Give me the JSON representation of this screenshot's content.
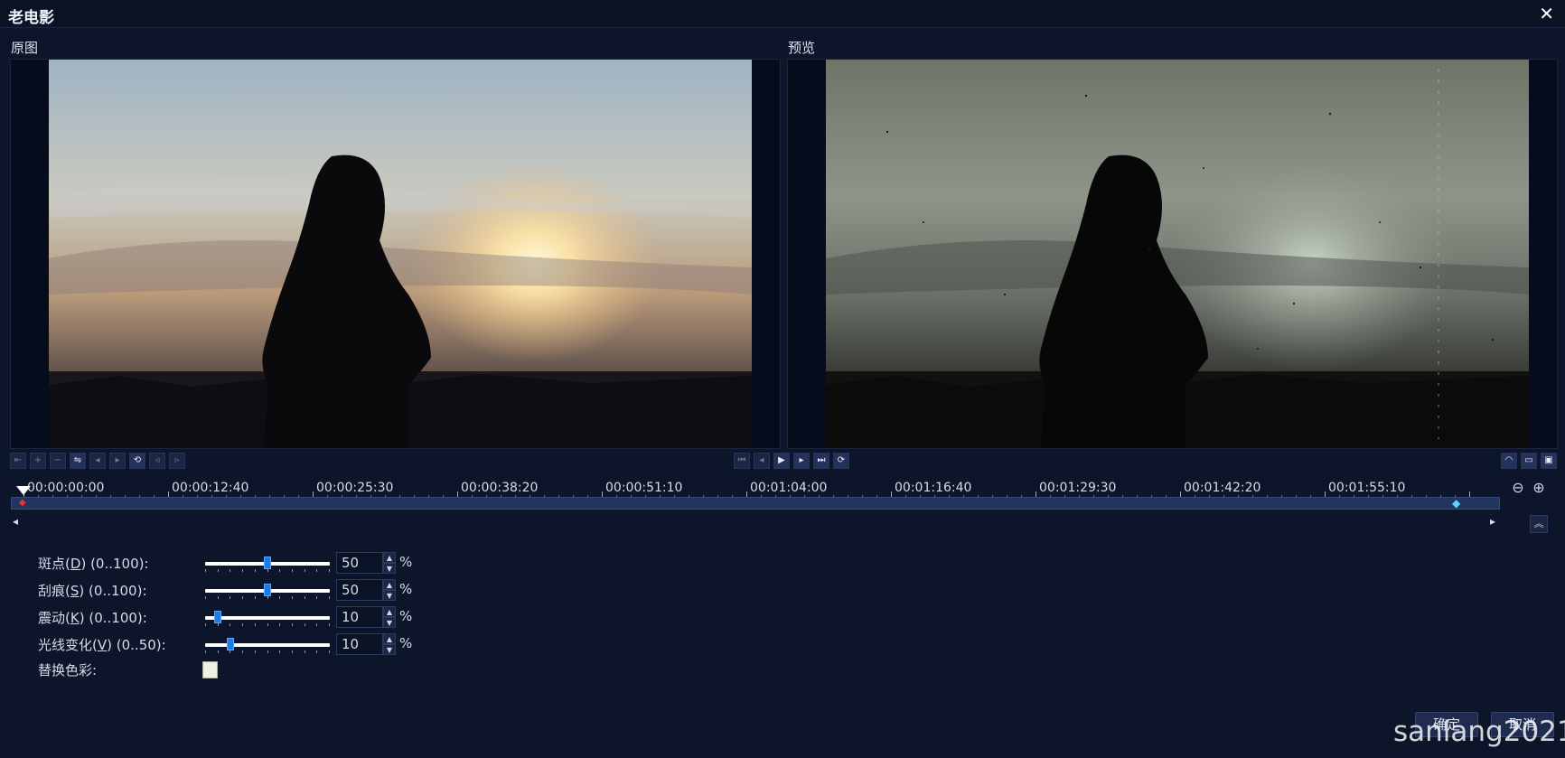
{
  "window": {
    "title": "老电影",
    "close_glyph": "✕"
  },
  "panes": {
    "original_label": "原图",
    "preview_label": "预览"
  },
  "timeline": {
    "labels": [
      "00:00:00:00",
      "00:00:12:40",
      "00:00:25:30",
      "00:00:38:20",
      "00:00:51:10",
      "00:01:04:00",
      "00:01:16:40",
      "00:01:29:30",
      "00:01:42:20",
      "00:01:55:10"
    ],
    "left_arrow": "◂",
    "right_arrow": "▸"
  },
  "params": [
    {
      "name": "斑点",
      "key": "D",
      "range": "(0..100):",
      "value": "50",
      "fraction": 0.5,
      "unit": "%"
    },
    {
      "name": "刮痕",
      "key": "S",
      "range": "(0..100):",
      "value": "50",
      "fraction": 0.5,
      "unit": "%"
    },
    {
      "name": "震动",
      "key": "K",
      "range": "(0..100):",
      "value": "10",
      "fraction": 0.1,
      "unit": "%"
    },
    {
      "name": "光线变化",
      "key": "V",
      "range": "(0..50):",
      "value": "10",
      "fraction": 0.2,
      "unit": "%"
    }
  ],
  "replace_color": {
    "label": "替换色彩:",
    "color": "#eef2e0"
  },
  "buttons": {
    "ok": "确定",
    "cancel": "取消"
  },
  "watermark": "sanlang2021",
  "colors": {
    "background": "#0c1529",
    "track": "#23355f",
    "thumb": "#1c7be6"
  }
}
